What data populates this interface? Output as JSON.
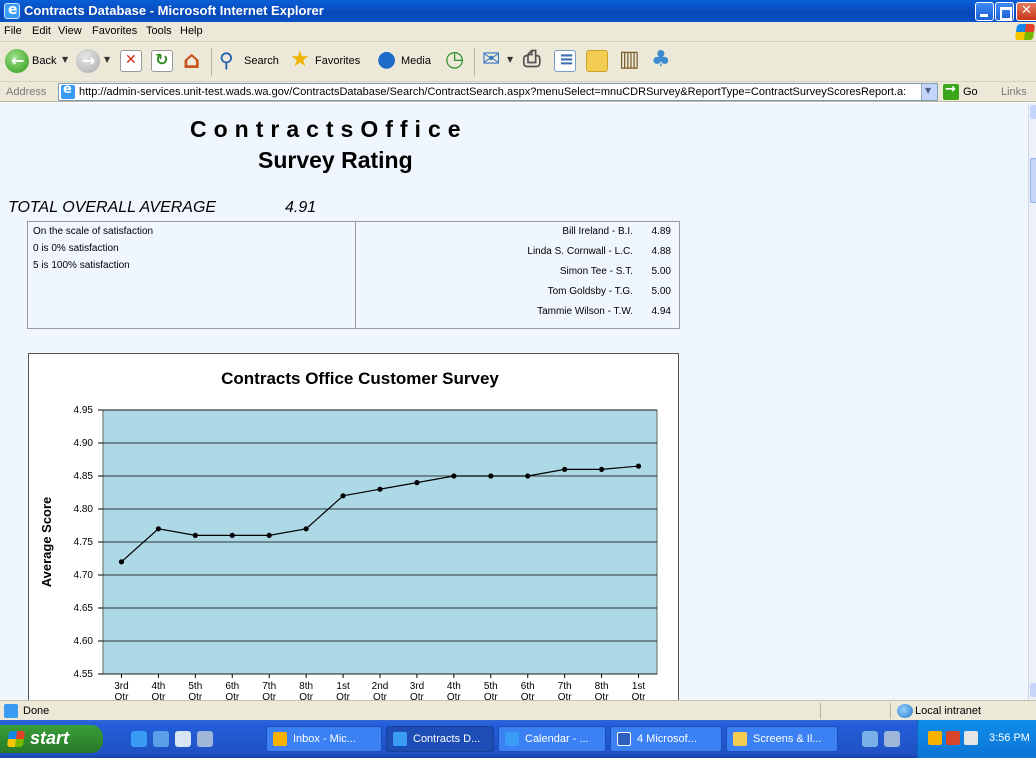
{
  "window": {
    "title": "Contracts Database - Microsoft Internet Explorer"
  },
  "menu": [
    "File",
    "Edit",
    "View",
    "Favorites",
    "Tools",
    "Help"
  ],
  "toolbar": {
    "back_label": "Back",
    "search_label": "Search",
    "favorites_label": "Favorites",
    "media_label": "Media"
  },
  "address": {
    "label": "Address",
    "url": "http://admin-services.unit-test.wads.wa.gov/ContractsDatabase/Search/ContractSearch.aspx?menuSelect=mnuCDRSurvey&ReportType=ContractSurveyScoresReport.a:",
    "go_label": "Go",
    "links_label": "Links"
  },
  "page": {
    "heading": "ContractsOffice",
    "subheading": "Survey Rating",
    "overall_label": "TOTAL OVERALL AVERAGE",
    "overall_value": "4.91",
    "scale_lines": [
      "On the scale of satisfaction",
      "0 is 0% satisfaction",
      "5 is 100% satisfaction"
    ],
    "staff": [
      {
        "name": "Bill Ireland - B.I.",
        "score": "4.89"
      },
      {
        "name": "Linda S. Cornwall - L.C.",
        "score": "4.88"
      },
      {
        "name": "Simon Tee - S.T.",
        "score": "5.00"
      },
      {
        "name": "Tom Goldsby - T.G.",
        "score": "5.00"
      },
      {
        "name": "Tammie Wilson - T.W.",
        "score": "4.94"
      }
    ]
  },
  "chart_data": {
    "type": "line",
    "title": "Contracts Office Customer Survey",
    "xlabel": "",
    "ylabel": "Average Score",
    "ylim": [
      4.55,
      4.95
    ],
    "yticks": [
      "4.95",
      "4.90",
      "4.85",
      "4.80",
      "4.75",
      "4.70",
      "4.65",
      "4.60",
      "4.55"
    ],
    "categories": [
      [
        "3rd",
        "Qtr"
      ],
      [
        "4th",
        "Qtr"
      ],
      [
        "5th",
        "Qtr"
      ],
      [
        "6th",
        "Qtr"
      ],
      [
        "7th",
        "Qtr"
      ],
      [
        "8th",
        "Qtr"
      ],
      [
        "1st",
        "Qtr"
      ],
      [
        "2nd",
        "Qtr"
      ],
      [
        "3rd",
        "Qtr"
      ],
      [
        "4th",
        "Qtr"
      ],
      [
        "5th",
        "Qtr"
      ],
      [
        "6th",
        "Qtr"
      ],
      [
        "7th",
        "Qtr"
      ],
      [
        "8th",
        "Qtr"
      ],
      [
        "1st",
        "Qtr"
      ]
    ],
    "values": [
      4.72,
      4.77,
      4.76,
      4.76,
      4.76,
      4.77,
      4.82,
      4.83,
      4.84,
      4.85,
      4.85,
      4.85,
      4.86,
      4.86,
      4.865
    ],
    "grid": true,
    "colors": {
      "plot_bg": "#add8e6",
      "line": "#000000"
    }
  },
  "status": {
    "text": "Done",
    "zone": "Local intranet"
  },
  "taskbar": {
    "start_label": "start",
    "tasks": [
      "Inbox - Mic...",
      "Contracts D...",
      "Calendar - ...",
      "4 Microsof...",
      "Screens & Il..."
    ],
    "clock": "3:56 PM"
  }
}
